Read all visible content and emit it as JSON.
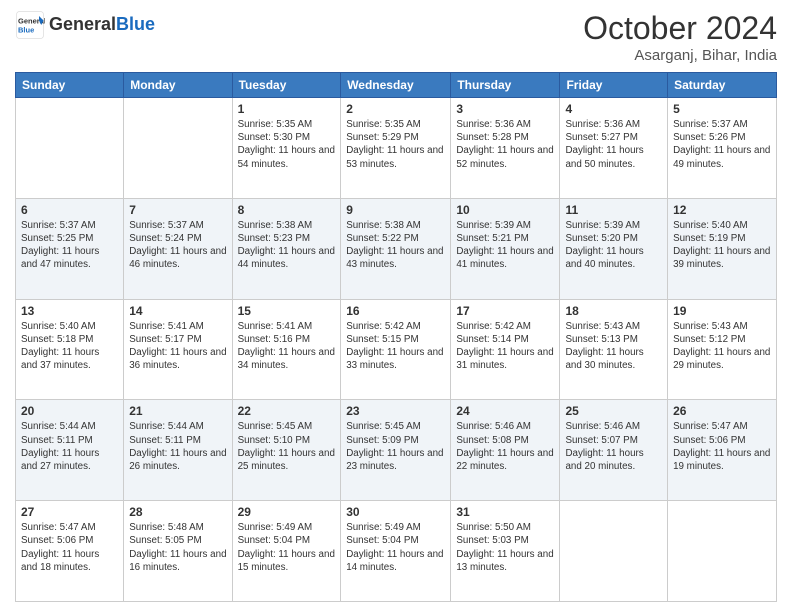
{
  "header": {
    "logo_general": "General",
    "logo_blue": "Blue",
    "month_title": "October 2024",
    "location": "Asarganj, Bihar, India"
  },
  "weekdays": [
    "Sunday",
    "Monday",
    "Tuesday",
    "Wednesday",
    "Thursday",
    "Friday",
    "Saturday"
  ],
  "weeks": [
    [
      {
        "day": "",
        "sunrise": "",
        "sunset": "",
        "daylight": ""
      },
      {
        "day": "",
        "sunrise": "",
        "sunset": "",
        "daylight": ""
      },
      {
        "day": "1",
        "sunrise": "Sunrise: 5:35 AM",
        "sunset": "Sunset: 5:30 PM",
        "daylight": "Daylight: 11 hours and 54 minutes."
      },
      {
        "day": "2",
        "sunrise": "Sunrise: 5:35 AM",
        "sunset": "Sunset: 5:29 PM",
        "daylight": "Daylight: 11 hours and 53 minutes."
      },
      {
        "day": "3",
        "sunrise": "Sunrise: 5:36 AM",
        "sunset": "Sunset: 5:28 PM",
        "daylight": "Daylight: 11 hours and 52 minutes."
      },
      {
        "day": "4",
        "sunrise": "Sunrise: 5:36 AM",
        "sunset": "Sunset: 5:27 PM",
        "daylight": "Daylight: 11 hours and 50 minutes."
      },
      {
        "day": "5",
        "sunrise": "Sunrise: 5:37 AM",
        "sunset": "Sunset: 5:26 PM",
        "daylight": "Daylight: 11 hours and 49 minutes."
      }
    ],
    [
      {
        "day": "6",
        "sunrise": "Sunrise: 5:37 AM",
        "sunset": "Sunset: 5:25 PM",
        "daylight": "Daylight: 11 hours and 47 minutes."
      },
      {
        "day": "7",
        "sunrise": "Sunrise: 5:37 AM",
        "sunset": "Sunset: 5:24 PM",
        "daylight": "Daylight: 11 hours and 46 minutes."
      },
      {
        "day": "8",
        "sunrise": "Sunrise: 5:38 AM",
        "sunset": "Sunset: 5:23 PM",
        "daylight": "Daylight: 11 hours and 44 minutes."
      },
      {
        "day": "9",
        "sunrise": "Sunrise: 5:38 AM",
        "sunset": "Sunset: 5:22 PM",
        "daylight": "Daylight: 11 hours and 43 minutes."
      },
      {
        "day": "10",
        "sunrise": "Sunrise: 5:39 AM",
        "sunset": "Sunset: 5:21 PM",
        "daylight": "Daylight: 11 hours and 41 minutes."
      },
      {
        "day": "11",
        "sunrise": "Sunrise: 5:39 AM",
        "sunset": "Sunset: 5:20 PM",
        "daylight": "Daylight: 11 hours and 40 minutes."
      },
      {
        "day": "12",
        "sunrise": "Sunrise: 5:40 AM",
        "sunset": "Sunset: 5:19 PM",
        "daylight": "Daylight: 11 hours and 39 minutes."
      }
    ],
    [
      {
        "day": "13",
        "sunrise": "Sunrise: 5:40 AM",
        "sunset": "Sunset: 5:18 PM",
        "daylight": "Daylight: 11 hours and 37 minutes."
      },
      {
        "day": "14",
        "sunrise": "Sunrise: 5:41 AM",
        "sunset": "Sunset: 5:17 PM",
        "daylight": "Daylight: 11 hours and 36 minutes."
      },
      {
        "day": "15",
        "sunrise": "Sunrise: 5:41 AM",
        "sunset": "Sunset: 5:16 PM",
        "daylight": "Daylight: 11 hours and 34 minutes."
      },
      {
        "day": "16",
        "sunrise": "Sunrise: 5:42 AM",
        "sunset": "Sunset: 5:15 PM",
        "daylight": "Daylight: 11 hours and 33 minutes."
      },
      {
        "day": "17",
        "sunrise": "Sunrise: 5:42 AM",
        "sunset": "Sunset: 5:14 PM",
        "daylight": "Daylight: 11 hours and 31 minutes."
      },
      {
        "day": "18",
        "sunrise": "Sunrise: 5:43 AM",
        "sunset": "Sunset: 5:13 PM",
        "daylight": "Daylight: 11 hours and 30 minutes."
      },
      {
        "day": "19",
        "sunrise": "Sunrise: 5:43 AM",
        "sunset": "Sunset: 5:12 PM",
        "daylight": "Daylight: 11 hours and 29 minutes."
      }
    ],
    [
      {
        "day": "20",
        "sunrise": "Sunrise: 5:44 AM",
        "sunset": "Sunset: 5:11 PM",
        "daylight": "Daylight: 11 hours and 27 minutes."
      },
      {
        "day": "21",
        "sunrise": "Sunrise: 5:44 AM",
        "sunset": "Sunset: 5:11 PM",
        "daylight": "Daylight: 11 hours and 26 minutes."
      },
      {
        "day": "22",
        "sunrise": "Sunrise: 5:45 AM",
        "sunset": "Sunset: 5:10 PM",
        "daylight": "Daylight: 11 hours and 25 minutes."
      },
      {
        "day": "23",
        "sunrise": "Sunrise: 5:45 AM",
        "sunset": "Sunset: 5:09 PM",
        "daylight": "Daylight: 11 hours and 23 minutes."
      },
      {
        "day": "24",
        "sunrise": "Sunrise: 5:46 AM",
        "sunset": "Sunset: 5:08 PM",
        "daylight": "Daylight: 11 hours and 22 minutes."
      },
      {
        "day": "25",
        "sunrise": "Sunrise: 5:46 AM",
        "sunset": "Sunset: 5:07 PM",
        "daylight": "Daylight: 11 hours and 20 minutes."
      },
      {
        "day": "26",
        "sunrise": "Sunrise: 5:47 AM",
        "sunset": "Sunset: 5:06 PM",
        "daylight": "Daylight: 11 hours and 19 minutes."
      }
    ],
    [
      {
        "day": "27",
        "sunrise": "Sunrise: 5:47 AM",
        "sunset": "Sunset: 5:06 PM",
        "daylight": "Daylight: 11 hours and 18 minutes."
      },
      {
        "day": "28",
        "sunrise": "Sunrise: 5:48 AM",
        "sunset": "Sunset: 5:05 PM",
        "daylight": "Daylight: 11 hours and 16 minutes."
      },
      {
        "day": "29",
        "sunrise": "Sunrise: 5:49 AM",
        "sunset": "Sunset: 5:04 PM",
        "daylight": "Daylight: 11 hours and 15 minutes."
      },
      {
        "day": "30",
        "sunrise": "Sunrise: 5:49 AM",
        "sunset": "Sunset: 5:04 PM",
        "daylight": "Daylight: 11 hours and 14 minutes."
      },
      {
        "day": "31",
        "sunrise": "Sunrise: 5:50 AM",
        "sunset": "Sunset: 5:03 PM",
        "daylight": "Daylight: 11 hours and 13 minutes."
      },
      {
        "day": "",
        "sunrise": "",
        "sunset": "",
        "daylight": ""
      },
      {
        "day": "",
        "sunrise": "",
        "sunset": "",
        "daylight": ""
      }
    ]
  ]
}
